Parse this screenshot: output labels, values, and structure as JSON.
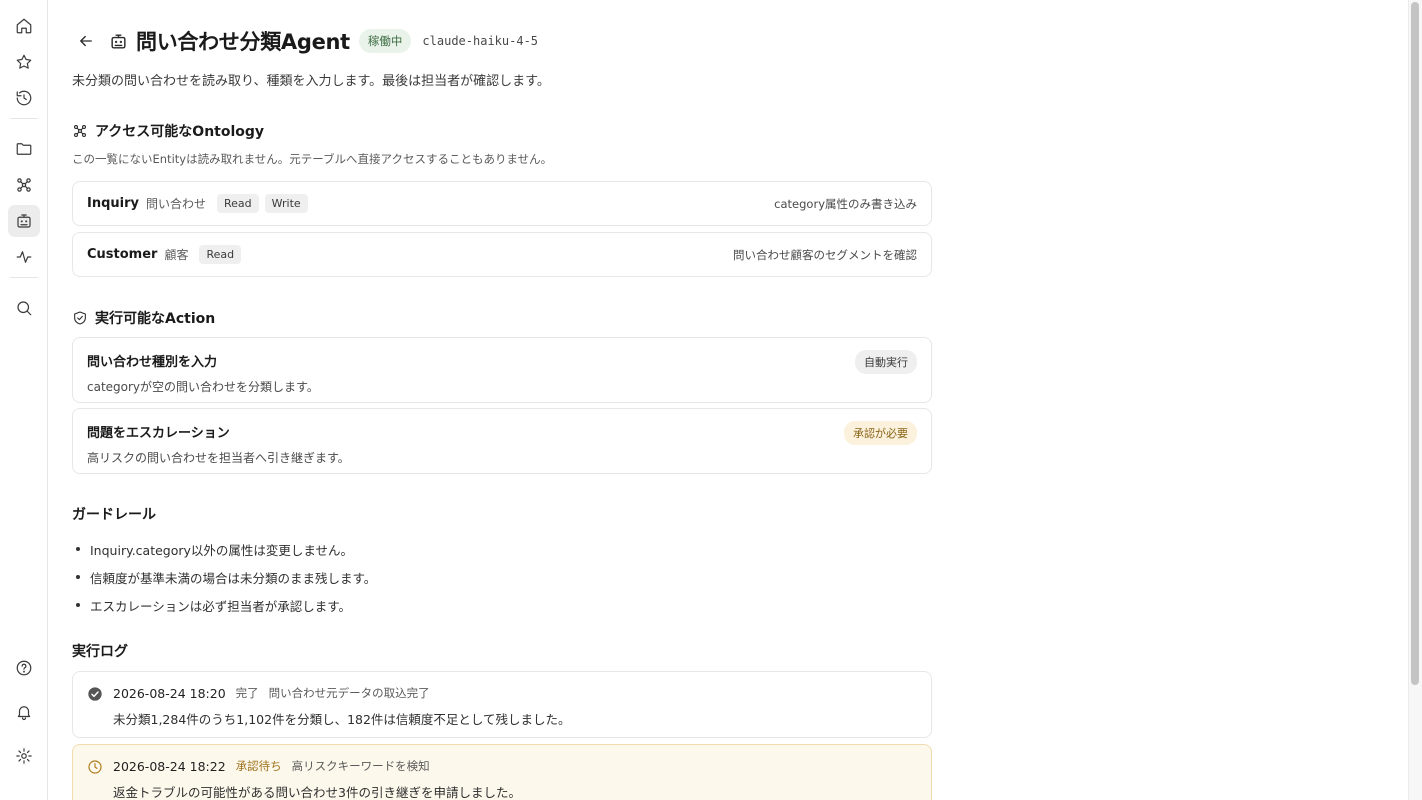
{
  "nav": {
    "items": [
      "home-icon",
      "star-icon",
      "history-icon",
      "folder-icon",
      "graph-icon",
      "agent-icon",
      "activity-icon",
      "search-icon"
    ],
    "bottom": [
      "help-icon",
      "bell-icon",
      "gear-icon"
    ],
    "active": "agent-icon"
  },
  "header": {
    "title": "問い合わせ分類Agent",
    "status": "稼働中",
    "model": "claude-haiku-4-5"
  },
  "description": "未分類の問い合わせを読み取り、種類を入力します。最後は担当者が確認します。",
  "ontology": {
    "title": "アクセス可能なOntology",
    "note": "この一覧にないEntityは読み取れません。元テーブルへ直接アクセスすることもありません。",
    "entities": [
      {
        "name": "Inquiry",
        "jp": "問い合わせ",
        "perms": [
          "Read",
          "Write"
        ],
        "note": "category属性のみ書き込み"
      },
      {
        "name": "Customer",
        "jp": "顧客",
        "perms": [
          "Read"
        ],
        "note": "問い合わせ顧客のセグメントを確認"
      }
    ]
  },
  "actions": {
    "title": "実行可能なAction",
    "items": [
      {
        "title": "問い合わせ種別を入力",
        "desc": "categoryが空の問い合わせを分類します。",
        "badge": "自動実行"
      },
      {
        "title": "問題をエスカレーション",
        "desc": "高リスクの問い合わせを担当者へ引き継ぎます。",
        "badge": "承認が必要"
      }
    ]
  },
  "guardrails": {
    "title": "ガードレール",
    "items": [
      "Inquiry.category以外の属性は変更しません。",
      "信頼度が基準未満の場合は未分類のまま残します。",
      "エスカレーションは必ず担当者が承認します。"
    ]
  },
  "log": {
    "title": "実行ログ",
    "entries": [
      {
        "time": "2026-08-24 18:20",
        "status": "完了",
        "event": "問い合わせ元データの取込完了",
        "message": "未分類1,284件のうち1,102件を分類し、182件は信頼度不足として残しました。"
      },
      {
        "time": "2026-08-24 18:22",
        "status": "承認待ち",
        "event": "高リスクキーワードを検知",
        "message": "返金トラブルの可能性がある問い合わせ3件の引き継ぎを申請しました。"
      }
    ]
  },
  "colors": {
    "status_running_bg": "#eaf3ea",
    "status_running_fg": "#3f6e44",
    "approval_bg": "#fbf1dc",
    "approval_fg": "#8a6418",
    "pending_card_bg": "#fdf8ec",
    "pending_card_border": "#f0dcae"
  }
}
